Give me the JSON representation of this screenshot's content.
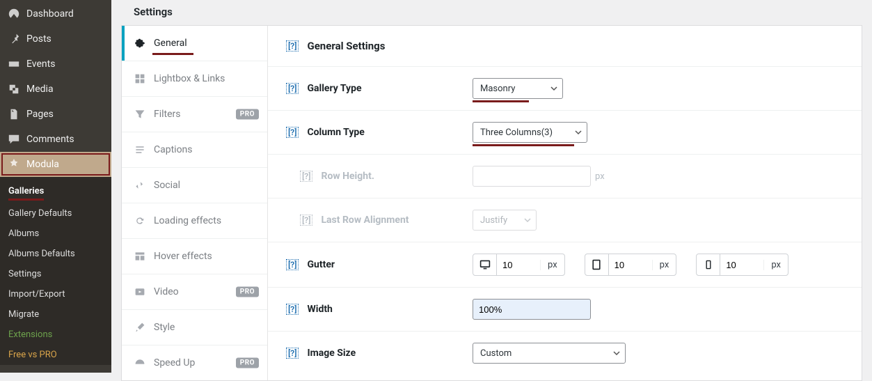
{
  "sidebar": {
    "items": [
      {
        "label": "Dashboard"
      },
      {
        "label": "Posts"
      },
      {
        "label": "Events"
      },
      {
        "label": "Media"
      },
      {
        "label": "Pages"
      },
      {
        "label": "Comments"
      },
      {
        "label": "Modula"
      }
    ],
    "sub": [
      {
        "label": "Galleries"
      },
      {
        "label": "Gallery Defaults"
      },
      {
        "label": "Albums"
      },
      {
        "label": "Albums Defaults"
      },
      {
        "label": "Settings"
      },
      {
        "label": "Import/Export"
      },
      {
        "label": "Migrate"
      },
      {
        "label": "Extensions"
      },
      {
        "label": "Free vs PRO"
      }
    ]
  },
  "page": {
    "title": "Settings"
  },
  "tabs": [
    {
      "label": "General"
    },
    {
      "label": "Lightbox & Links"
    },
    {
      "label": "Filters",
      "pro": "PRO"
    },
    {
      "label": "Captions"
    },
    {
      "label": "Social"
    },
    {
      "label": "Loading effects"
    },
    {
      "label": "Hover effects"
    },
    {
      "label": "Video",
      "pro": "PRO"
    },
    {
      "label": "Style"
    },
    {
      "label": "Speed Up",
      "pro": "PRO"
    }
  ],
  "section": {
    "title": "General Settings",
    "help": "[?]"
  },
  "fields": {
    "help": "[?]",
    "gallery_type": {
      "label": "Gallery Type",
      "value": "Masonry"
    },
    "column_type": {
      "label": "Column Type",
      "value": "Three Columns(3)"
    },
    "row_height": {
      "label": "Row Height.",
      "value": "",
      "unit": "px"
    },
    "last_row": {
      "label": "Last Row Alignment",
      "value": "Justify"
    },
    "gutter": {
      "label": "Gutter",
      "desktop": {
        "value": "10",
        "unit": "px"
      },
      "tablet": {
        "value": "10",
        "unit": "px"
      },
      "mobile": {
        "value": "10",
        "unit": "px"
      }
    },
    "width": {
      "label": "Width",
      "value": "100%"
    },
    "image_size": {
      "label": "Image Size",
      "value": "Custom"
    }
  }
}
